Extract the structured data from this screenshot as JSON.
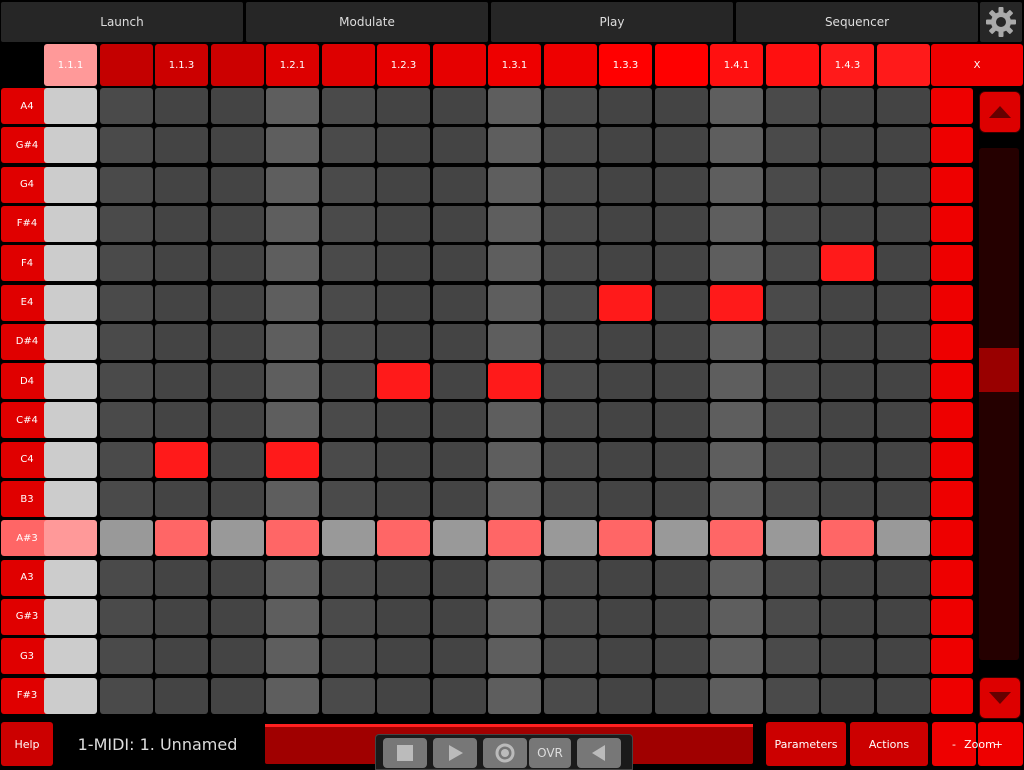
{
  "tabs": {
    "launch": "Launch",
    "modulate": "Modulate",
    "play": "Play",
    "sequencer": "Sequencer"
  },
  "header_labels": [
    "1.1.1",
    "",
    "1.1.3",
    "",
    "1.2.1",
    "",
    "1.2.3",
    "",
    "1.3.1",
    "",
    "1.3.3",
    "",
    "1.4.1",
    "",
    "1.4.3",
    ""
  ],
  "header_clear": "X",
  "notes": [
    "A4",
    "G#4",
    "G4",
    "F#4",
    "F4",
    "E4",
    "D#4",
    "D4",
    "C#4",
    "C4",
    "B3",
    "A#3",
    "A3",
    "G#3",
    "G3",
    "F#3"
  ],
  "active_steps": [
    {
      "note": "C4",
      "step": 3
    },
    {
      "note": "C4",
      "step": 5
    },
    {
      "note": "D4",
      "step": 7
    },
    {
      "note": "D4",
      "step": 9
    },
    {
      "note": "E4",
      "step": 11
    },
    {
      "note": "E4",
      "step": 13
    },
    {
      "note": "F4",
      "step": 15
    }
  ],
  "highlighted_note": "A#3",
  "bottom": {
    "help": "Help",
    "track": "1-MIDI: 1. Unnamed",
    "overdub": "OVR",
    "parameters": "Parameters",
    "actions": "Actions",
    "zoom_minus": "-",
    "zoom_label": "Zoom",
    "zoom_plus": "+"
  },
  "colors": {
    "accent": "#ee0000",
    "active_step": "#ff1a1a",
    "cursor_column": "#cccccc"
  }
}
